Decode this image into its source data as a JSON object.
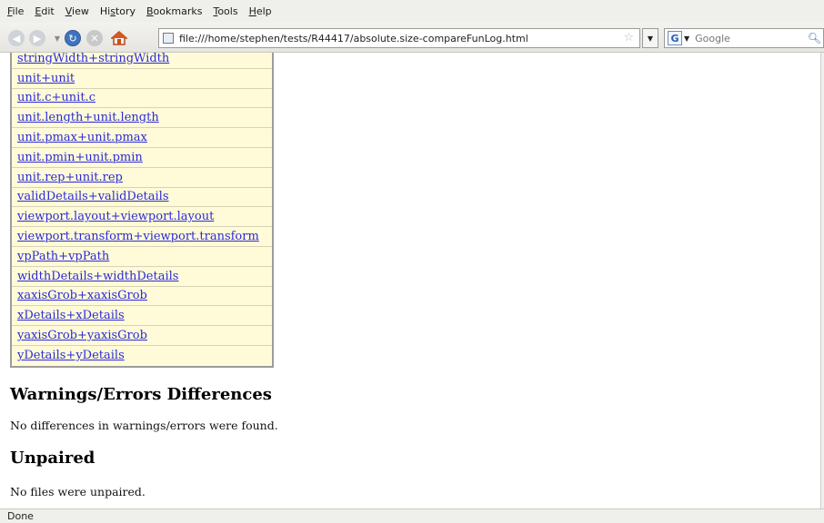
{
  "menubar": {
    "items": [
      {
        "accel": "F",
        "rest": "ile"
      },
      {
        "accel": "E",
        "rest": "dit"
      },
      {
        "accel": "V",
        "rest": "iew"
      },
      {
        "pre": "Hi",
        "accel": "s",
        "rest": "tory"
      },
      {
        "accel": "B",
        "rest": "ookmarks"
      },
      {
        "accel": "T",
        "rest": "ools"
      },
      {
        "accel": "H",
        "rest": "elp"
      }
    ]
  },
  "navbar": {
    "url": "file:///home/stephen/tests/R44417/absolute.size-compareFunLog.html",
    "search_placeholder": "Google",
    "search_engine_letter": "G"
  },
  "functions": {
    "links": [
      "stringWidth+stringWidth",
      "unit+unit",
      "unit.c+unit.c",
      "unit.length+unit.length",
      "unit.pmax+unit.pmax",
      "unit.pmin+unit.pmin",
      "unit.rep+unit.rep",
      "validDetails+validDetails",
      "viewport.layout+viewport.layout",
      "viewport.transform+viewport.transform",
      "vpPath+vpPath",
      "widthDetails+widthDetails",
      "xaxisGrob+xaxisGrob",
      "xDetails+xDetails",
      "yaxisGrob+yaxisGrob",
      "yDetails+yDetails"
    ]
  },
  "sections": {
    "warnings_heading": "Warnings/Errors Differences",
    "warnings_text": "No differences in warnings/errors were found.",
    "unpaired_heading": "Unpaired",
    "unpaired_text": "No files were unpaired."
  },
  "status": {
    "text": "Done"
  }
}
